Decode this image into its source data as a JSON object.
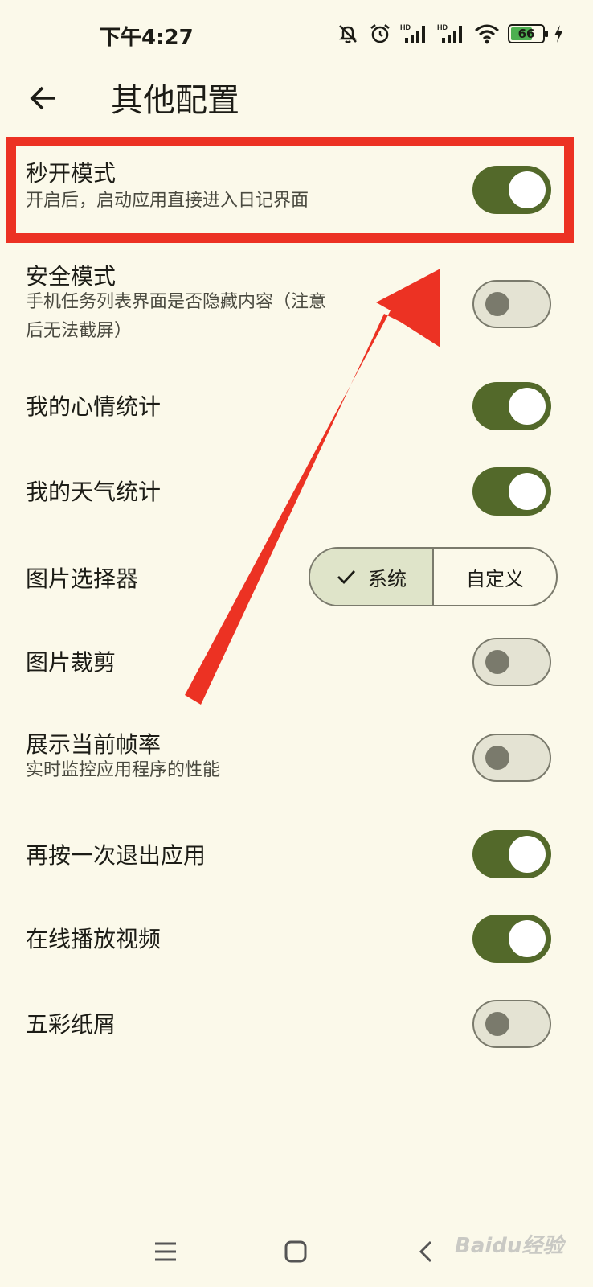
{
  "status_bar": {
    "time": "下午4:27",
    "battery_level": 66,
    "battery_label": "66",
    "icons": [
      "mute-icon",
      "alarm-icon",
      "hd-signal-icon",
      "hd-signal-icon",
      "wifi-icon",
      "battery-icon",
      "charging-icon"
    ]
  },
  "header": {
    "title": "其他配置",
    "back_icon": "arrow-left-icon"
  },
  "settings": [
    {
      "key": "quick_open",
      "title": "秒开模式",
      "subtitle": "开启后，启动应用直接进入日记界面",
      "enabled": true
    },
    {
      "key": "safe_mode",
      "title": "安全模式",
      "subtitle": "手机任务列表界面是否隐藏内容（注意",
      "subtitle2": "后无法截屏）",
      "enabled": false
    },
    {
      "key": "mood_stats",
      "title": "我的心情统计",
      "enabled": true
    },
    {
      "key": "weather_stats",
      "title": "我的天气统计",
      "enabled": true
    },
    {
      "key": "image_picker",
      "title": "图片选择器",
      "options": [
        "系统",
        "自定义"
      ],
      "selected": "系统"
    },
    {
      "key": "image_crop",
      "title": "图片裁剪",
      "enabled": false
    },
    {
      "key": "show_fps",
      "title": "展示当前帧率",
      "subtitle": "实时监控应用程序的性能",
      "enabled": false
    },
    {
      "key": "double_back_exit",
      "title": "再按一次退出应用",
      "enabled": true
    },
    {
      "key": "online_video",
      "title": "在线播放视频",
      "enabled": true
    },
    {
      "key": "confetti",
      "title": "五彩纸屑",
      "enabled": false
    }
  ],
  "colors": {
    "background": "#fbf9ea",
    "switch_on": "#53692a",
    "switch_off_track": "#e4e3d3",
    "annotation_red": "#ec3223"
  },
  "nav_bar": {
    "icons": [
      "menu-icon",
      "home-square-icon",
      "back-chevron-icon"
    ]
  },
  "watermark": "Baidu经验"
}
